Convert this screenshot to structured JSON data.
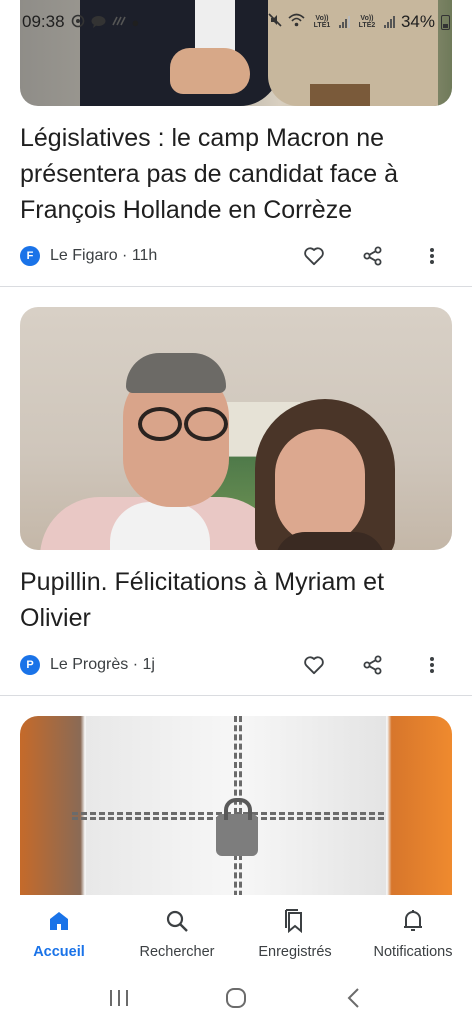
{
  "status_bar": {
    "time": "09:38",
    "left_icons": [
      "whatsapp-icon",
      "messenger-icon",
      "wifi-calling-icon",
      "dot"
    ],
    "volte1": "Vo)) LTE1",
    "volte2": "Vo)) LTE2",
    "battery": "34%"
  },
  "articles": [
    {
      "headline": "Législatives : le camp Macron ne présentera pas de candidat face à François Hollande en Corrèze",
      "source_logo": "F",
      "source": "Le Figaro · 11h"
    },
    {
      "headline": "Pupillin. Félicitations à Myriam et Olivier",
      "source_logo": "P",
      "source": "Le Progrès · 1j"
    }
  ],
  "bottom_nav": {
    "items": [
      {
        "label": "Accueil",
        "icon": "home-icon",
        "active": true
      },
      {
        "label": "Rechercher",
        "icon": "search-icon",
        "active": false
      },
      {
        "label": "Enregistrés",
        "icon": "saved-icon",
        "active": false
      },
      {
        "label": "Notifications",
        "icon": "bell-icon",
        "active": false
      }
    ]
  },
  "colors": {
    "accent": "#1a73e8",
    "text": "#1f1f1f",
    "secondary_text": "#3c4043",
    "divider": "#dadce0"
  }
}
